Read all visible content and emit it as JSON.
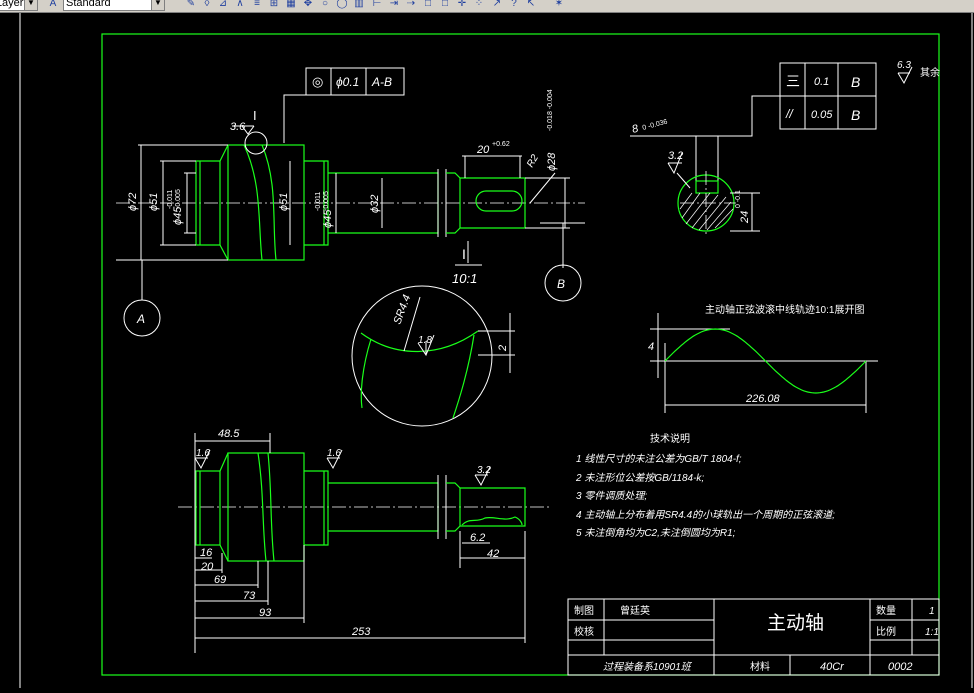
{
  "toolbar": {
    "layer_combo": "ByLayer",
    "style_combo": "Standard",
    "icons": [
      "draw-icon",
      "eraser-icon",
      "measure-icon",
      "text-icon",
      "block-icon",
      "move-icon",
      "rotate-icon",
      "table-icon",
      "dimension-icon",
      "arrow-icon",
      "rect-icon",
      "rect-icon",
      "snap-icon",
      "question-icon",
      "fire-icon"
    ]
  },
  "drawing": {
    "tolerance_frame": {
      "symbol": "◎",
      "value": "ϕ0.1",
      "datum": "A-B"
    },
    "section_tolerance": {
      "row1": {
        "symbol": "三",
        "value": "0.1",
        "datum": "B"
      },
      "row2": {
        "symbol": "//",
        "value": "0.05",
        "datum": "B"
      }
    },
    "roughness_general": "6.3",
    "roughness_note": "其余",
    "main_view": {
      "roughness_top": "3.6",
      "detail_marker": "I",
      "dim_d72": "ϕ72",
      "dim_d51_left": "ϕ51",
      "dim_d45_left": "ϕ45",
      "dim_d45_left_tol_up": "-0.011",
      "dim_d45_left_tol_low": "-0.005",
      "dim_d51_right": "ϕ51",
      "dim_d45_right": "ϕ45",
      "dim_d45_right_tol_up": "-0.011",
      "dim_d45_right_tol_low": "-0.005",
      "dim_d32": "ϕ32",
      "dim_20": "20",
      "dim_20_tol": "+0.62",
      "dim_d28": "ϕ28",
      "dim_d28_tol": "-0.018 -0.004",
      "keyway_roughness": "R2",
      "datum_a": "A",
      "datum_b": "B"
    },
    "section_view": {
      "dim_8": "8",
      "dim_8_tol": "0 -0.036",
      "roughness": "3.2",
      "dim_24": "24",
      "dim_24_tol": "0 -0.1"
    },
    "detail_view": {
      "label": "I",
      "scale": "10:1",
      "radius": "SR4.4",
      "roughness": "1.8",
      "dim_depth": "2"
    },
    "cam_curve": {
      "title": "主动轴正弦波滚中线轨迹10:1展开图",
      "height": "4",
      "length": "226.08"
    },
    "bottom_view": {
      "dim_48_5": "48.5",
      "roughness_left": "1.6",
      "roughness_mid": "1.6",
      "roughness_right": "3.2",
      "dim_16": "16",
      "dim_20": "20",
      "dim_69": "69",
      "dim_73": "73",
      "dim_93": "93",
      "dim_253": "253",
      "dim_6_2": "6.2",
      "dim_42": "42"
    },
    "tech_notes": {
      "title": "技术说明",
      "lines": [
        "1 线性尺寸的未注公差为GB/T 1804-f;",
        "2 未注形位公差按GB/1184-k;",
        "3 零件调质处理;",
        "4 主动轴上分布着用SR4.4的小球轨出一个周期的正弦滚道;",
        "5 未注倒角均为C2,未注倒圆均为R1;"
      ]
    },
    "title_block": {
      "draw_label": "制图",
      "draw_name": "曾廷英",
      "check_label": "校核",
      "part_name": "主动轴",
      "qty_label": "数量",
      "qty_value": "1",
      "scale_label": "比例",
      "scale_value": "1:1",
      "class_name": "过程装备系10901班",
      "material_label": "材料",
      "material_value": "40Cr",
      "drawing_no": "0002"
    }
  }
}
